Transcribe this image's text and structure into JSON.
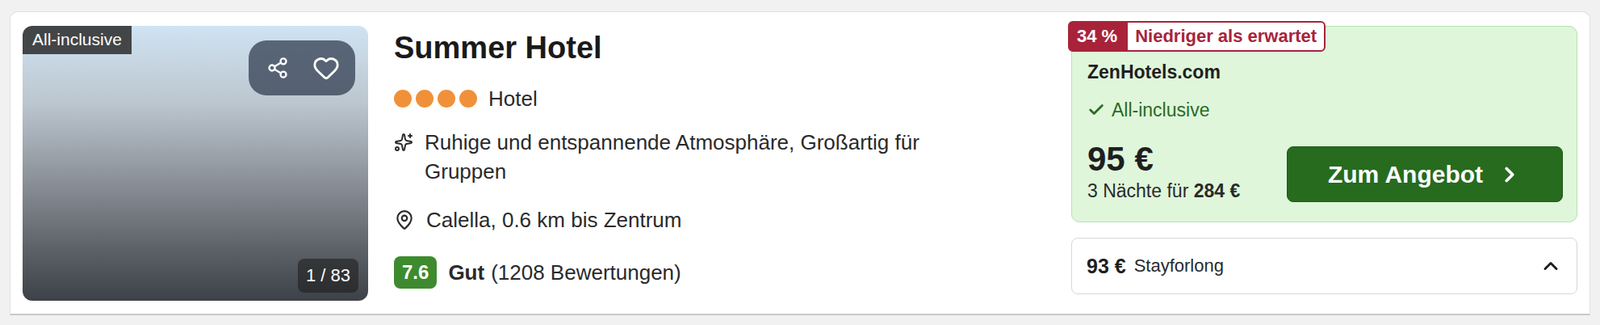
{
  "card": {
    "image": {
      "badge": "All-inclusive",
      "counter": "1 / 83",
      "favorited": false
    },
    "name": "Summer Hotel",
    "stars": 4,
    "type": "Hotel",
    "highlights": "Ruhige und entspannende Atmosphäre, Großartig für Gruppen",
    "location": "Calella, 0.6 km bis Zentrum",
    "rating": {
      "score": "7.6",
      "label": "Gut",
      "count": "(1208 Bewertungen)"
    }
  },
  "deal": {
    "discount": "34 %",
    "note": "Niedriger als erwartet",
    "provider": "ZenHotels.com",
    "feature": "All-inclusive",
    "price": "95 €",
    "total_prefix": "3 Nächte für",
    "total": "284 €",
    "button": "Zum Angebot"
  },
  "other_offers": {
    "price": "93 €",
    "provider": "Stayforlong",
    "expanded": true
  }
}
